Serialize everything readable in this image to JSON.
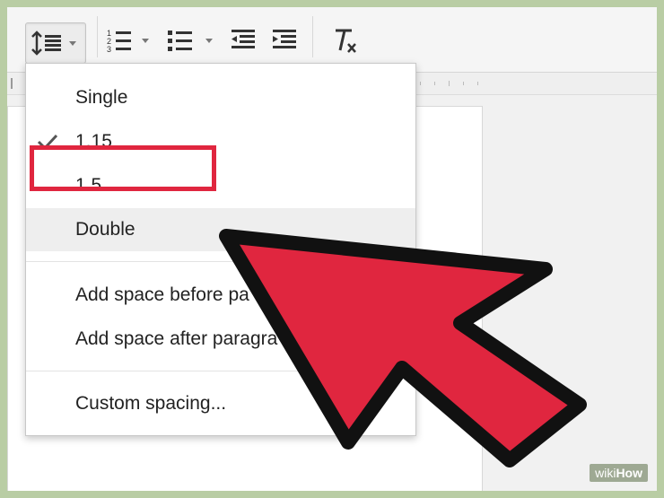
{
  "toolbar": {
    "line_spacing_button": "line-spacing",
    "numbered_list_button": "numbered-list",
    "bulleted_list_button": "bulleted-list",
    "decrease_indent_button": "decrease-indent",
    "increase_indent_button": "increase-indent",
    "clear_formatting_button": "clear-formatting"
  },
  "line_spacing_menu": {
    "items": [
      {
        "label": "Single",
        "checked": false
      },
      {
        "label": "1.15",
        "checked": true
      },
      {
        "label": "1.5",
        "checked": false
      },
      {
        "label": "Double",
        "checked": false,
        "highlighted": true
      }
    ],
    "paragraph_items": [
      {
        "label": "Add space before pa"
      },
      {
        "label": "Add space after paragra"
      }
    ],
    "custom_label": "Custom spacing..."
  },
  "annotation": {
    "arrow_color": "#e0263f",
    "outline_color": "#111111",
    "box_color": "#e0263f"
  },
  "watermark": {
    "prefix": "wiki",
    "suffix": "How"
  }
}
